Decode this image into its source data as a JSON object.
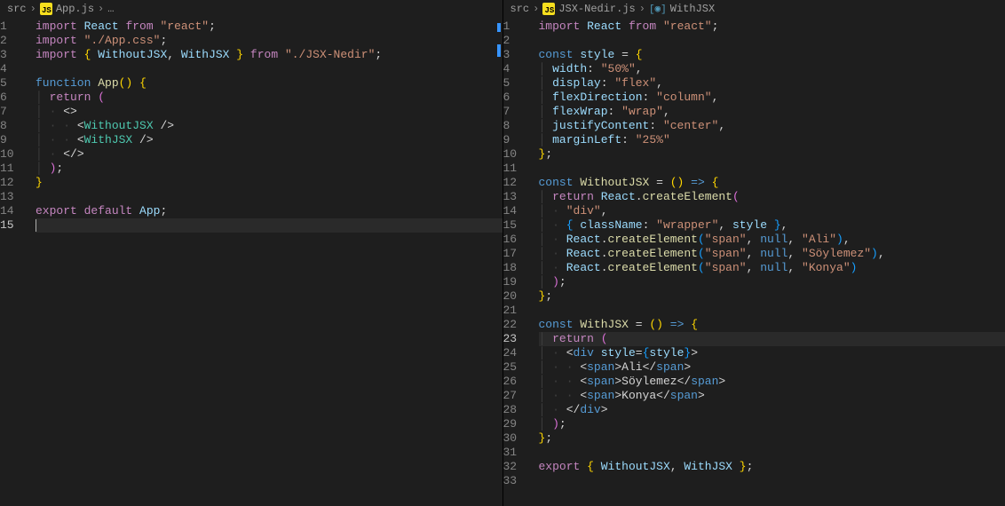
{
  "leftPane": {
    "breadcrumb": {
      "root": "src",
      "file": "App.js",
      "rest": "…"
    },
    "lines": [
      {
        "n": 1,
        "tokens": [
          [
            "k1",
            "import"
          ],
          [
            "punc",
            " "
          ],
          [
            "id",
            "React"
          ],
          [
            "punc",
            " "
          ],
          [
            "k1",
            "from"
          ],
          [
            "punc",
            " "
          ],
          [
            "str",
            "\"react\""
          ],
          [
            "punc",
            ";"
          ]
        ]
      },
      {
        "n": 2,
        "tokens": [
          [
            "k1",
            "import"
          ],
          [
            "punc",
            " "
          ],
          [
            "str",
            "\"./App.css\""
          ],
          [
            "punc",
            ";"
          ]
        ]
      },
      {
        "n": 3,
        "tokens": [
          [
            "k1",
            "import"
          ],
          [
            "punc",
            " "
          ],
          [
            "brace-y",
            "{"
          ],
          [
            "punc",
            " "
          ],
          [
            "id",
            "WithoutJSX"
          ],
          [
            "punc",
            ", "
          ],
          [
            "id",
            "WithJSX"
          ],
          [
            "punc",
            " "
          ],
          [
            "brace-y",
            "}"
          ],
          [
            "punc",
            " "
          ],
          [
            "k1",
            "from"
          ],
          [
            "punc",
            " "
          ],
          [
            "str",
            "\"./JSX-Nedir\""
          ],
          [
            "punc",
            ";"
          ]
        ]
      },
      {
        "n": 4,
        "tokens": []
      },
      {
        "n": 5,
        "tokens": [
          [
            "k2",
            "function"
          ],
          [
            "punc",
            " "
          ],
          [
            "fn",
            "App"
          ],
          [
            "brace-y",
            "()"
          ],
          [
            "punc",
            " "
          ],
          [
            "brace-y",
            "{"
          ]
        ]
      },
      {
        "n": 6,
        "tokens": [
          [
            "guide",
            "│ "
          ],
          [
            "k1",
            "return"
          ],
          [
            "punc",
            " "
          ],
          [
            "brace-p",
            "("
          ]
        ]
      },
      {
        "n": 7,
        "tokens": [
          [
            "guide",
            "│ · "
          ],
          [
            "punc",
            "<>"
          ]
        ]
      },
      {
        "n": 8,
        "tokens": [
          [
            "guide",
            "│ · · "
          ],
          [
            "punc",
            "<"
          ],
          [
            "tagname",
            "WithoutJSX"
          ],
          [
            "punc",
            " />"
          ]
        ]
      },
      {
        "n": 9,
        "tokens": [
          [
            "guide",
            "│ · · "
          ],
          [
            "punc",
            "<"
          ],
          [
            "tagname",
            "WithJSX"
          ],
          [
            "punc",
            " />"
          ]
        ]
      },
      {
        "n": 10,
        "tokens": [
          [
            "guide",
            "│ · "
          ],
          [
            "punc",
            "</>"
          ]
        ]
      },
      {
        "n": 11,
        "tokens": [
          [
            "guide",
            "│ "
          ],
          [
            "brace-p",
            ")"
          ],
          [
            "punc",
            ";"
          ]
        ]
      },
      {
        "n": 12,
        "tokens": [
          [
            "brace-y",
            "}"
          ]
        ]
      },
      {
        "n": 13,
        "tokens": []
      },
      {
        "n": 14,
        "tokens": [
          [
            "k1",
            "export"
          ],
          [
            "punc",
            " "
          ],
          [
            "k1",
            "default"
          ],
          [
            "punc",
            " "
          ],
          [
            "id",
            "App"
          ],
          [
            "punc",
            ";"
          ]
        ]
      },
      {
        "n": 15,
        "tokens": [],
        "current": true,
        "cursor": true
      }
    ]
  },
  "rightPane": {
    "breadcrumb": {
      "root": "src",
      "file": "JSX-Nedir.js",
      "symbol": "WithJSX"
    },
    "lines": [
      {
        "n": 1,
        "tokens": [
          [
            "k1",
            "import"
          ],
          [
            "punc",
            " "
          ],
          [
            "id",
            "React"
          ],
          [
            "punc",
            " "
          ],
          [
            "k1",
            "from"
          ],
          [
            "punc",
            " "
          ],
          [
            "str",
            "\"react\""
          ],
          [
            "punc",
            ";"
          ]
        ]
      },
      {
        "n": 2,
        "tokens": []
      },
      {
        "n": 3,
        "tokens": [
          [
            "k2",
            "const"
          ],
          [
            "punc",
            " "
          ],
          [
            "id",
            "style"
          ],
          [
            "punc",
            " = "
          ],
          [
            "brace-y",
            "{"
          ]
        ]
      },
      {
        "n": 4,
        "tokens": [
          [
            "guide",
            "│ "
          ],
          [
            "id",
            "width"
          ],
          [
            "punc",
            ": "
          ],
          [
            "str",
            "\"50%\""
          ],
          [
            "punc",
            ","
          ]
        ]
      },
      {
        "n": 5,
        "tokens": [
          [
            "guide",
            "│ "
          ],
          [
            "id",
            "display"
          ],
          [
            "punc",
            ": "
          ],
          [
            "str",
            "\"flex\""
          ],
          [
            "punc",
            ","
          ]
        ]
      },
      {
        "n": 6,
        "tokens": [
          [
            "guide",
            "│ "
          ],
          [
            "id",
            "flexDirection"
          ],
          [
            "punc",
            ": "
          ],
          [
            "str",
            "\"column\""
          ],
          [
            "punc",
            ","
          ]
        ]
      },
      {
        "n": 7,
        "tokens": [
          [
            "guide",
            "│ "
          ],
          [
            "id",
            "flexWrap"
          ],
          [
            "punc",
            ": "
          ],
          [
            "str",
            "\"wrap\""
          ],
          [
            "punc",
            ","
          ]
        ]
      },
      {
        "n": 8,
        "tokens": [
          [
            "guide",
            "│ "
          ],
          [
            "id",
            "justifyContent"
          ],
          [
            "punc",
            ": "
          ],
          [
            "str",
            "\"center\""
          ],
          [
            "punc",
            ","
          ]
        ]
      },
      {
        "n": 9,
        "tokens": [
          [
            "guide",
            "│ "
          ],
          [
            "id",
            "marginLeft"
          ],
          [
            "punc",
            ": "
          ],
          [
            "str",
            "\"25%\""
          ]
        ]
      },
      {
        "n": 10,
        "tokens": [
          [
            "brace-y",
            "}"
          ],
          [
            "punc",
            ";"
          ]
        ]
      },
      {
        "n": 11,
        "tokens": []
      },
      {
        "n": 12,
        "tokens": [
          [
            "k2",
            "const"
          ],
          [
            "punc",
            " "
          ],
          [
            "fn",
            "WithoutJSX"
          ],
          [
            "punc",
            " = "
          ],
          [
            "brace-y",
            "()"
          ],
          [
            "punc",
            " "
          ],
          [
            "k2",
            "=>"
          ],
          [
            "punc",
            " "
          ],
          [
            "brace-y",
            "{"
          ]
        ]
      },
      {
        "n": 13,
        "tokens": [
          [
            "guide",
            "│ "
          ],
          [
            "k1",
            "return"
          ],
          [
            "punc",
            " "
          ],
          [
            "id",
            "React"
          ],
          [
            "punc",
            "."
          ],
          [
            "fn",
            "createElement"
          ],
          [
            "brace-p",
            "("
          ]
        ]
      },
      {
        "n": 14,
        "tokens": [
          [
            "guide",
            "│ · "
          ],
          [
            "str",
            "\"div\""
          ],
          [
            "punc",
            ","
          ]
        ]
      },
      {
        "n": 15,
        "tokens": [
          [
            "guide",
            "│ · "
          ],
          [
            "brace-b",
            "{"
          ],
          [
            "punc",
            " "
          ],
          [
            "id",
            "className"
          ],
          [
            "punc",
            ": "
          ],
          [
            "str",
            "\"wrapper\""
          ],
          [
            "punc",
            ", "
          ],
          [
            "id",
            "style"
          ],
          [
            "punc",
            " "
          ],
          [
            "brace-b",
            "}"
          ],
          [
            "punc",
            ","
          ]
        ]
      },
      {
        "n": 16,
        "tokens": [
          [
            "guide",
            "│ · "
          ],
          [
            "id",
            "React"
          ],
          [
            "punc",
            "."
          ],
          [
            "fn",
            "createElement"
          ],
          [
            "brace-b",
            "("
          ],
          [
            "str",
            "\"span\""
          ],
          [
            "punc",
            ", "
          ],
          [
            "k2",
            "null"
          ],
          [
            "punc",
            ", "
          ],
          [
            "str",
            "\"Ali\""
          ],
          [
            "brace-b",
            ")"
          ],
          [
            "punc",
            ","
          ]
        ]
      },
      {
        "n": 17,
        "tokens": [
          [
            "guide",
            "│ · "
          ],
          [
            "id",
            "React"
          ],
          [
            "punc",
            "."
          ],
          [
            "fn",
            "createElement"
          ],
          [
            "brace-b",
            "("
          ],
          [
            "str",
            "\"span\""
          ],
          [
            "punc",
            ", "
          ],
          [
            "k2",
            "null"
          ],
          [
            "punc",
            ", "
          ],
          [
            "str",
            "\"Söylemez\""
          ],
          [
            "brace-b",
            ")"
          ],
          [
            "punc",
            ","
          ]
        ]
      },
      {
        "n": 18,
        "tokens": [
          [
            "guide",
            "│ · "
          ],
          [
            "id",
            "React"
          ],
          [
            "punc",
            "."
          ],
          [
            "fn",
            "createElement"
          ],
          [
            "brace-b",
            "("
          ],
          [
            "str",
            "\"span\""
          ],
          [
            "punc",
            ", "
          ],
          [
            "k2",
            "null"
          ],
          [
            "punc",
            ", "
          ],
          [
            "str",
            "\"Konya\""
          ],
          [
            "brace-b",
            ")"
          ]
        ]
      },
      {
        "n": 19,
        "tokens": [
          [
            "guide",
            "│ "
          ],
          [
            "brace-p",
            ")"
          ],
          [
            "punc",
            ";"
          ]
        ]
      },
      {
        "n": 20,
        "tokens": [
          [
            "brace-y",
            "}"
          ],
          [
            "punc",
            ";"
          ]
        ]
      },
      {
        "n": 21,
        "tokens": []
      },
      {
        "n": 22,
        "tokens": [
          [
            "k2",
            "const"
          ],
          [
            "punc",
            " "
          ],
          [
            "fn",
            "WithJSX"
          ],
          [
            "punc",
            " = "
          ],
          [
            "brace-y",
            "()"
          ],
          [
            "punc",
            " "
          ],
          [
            "k2",
            "=>"
          ],
          [
            "punc",
            " "
          ],
          [
            "brace-y",
            "{"
          ]
        ]
      },
      {
        "n": 23,
        "tokens": [
          [
            "guide",
            "│ "
          ],
          [
            "k1",
            "return"
          ],
          [
            "punc",
            " "
          ],
          [
            "brace-p",
            "("
          ]
        ],
        "current": true
      },
      {
        "n": 24,
        "tokens": [
          [
            "guide",
            "│ · "
          ],
          [
            "punc",
            "<"
          ],
          [
            "tag",
            "div"
          ],
          [
            "punc",
            " "
          ],
          [
            "id",
            "style"
          ],
          [
            "punc",
            "="
          ],
          [
            "brace-b",
            "{"
          ],
          [
            "id",
            "style"
          ],
          [
            "brace-b",
            "}"
          ],
          [
            "punc",
            ">"
          ]
        ]
      },
      {
        "n": 25,
        "tokens": [
          [
            "guide",
            "│ · · "
          ],
          [
            "punc",
            "<"
          ],
          [
            "tag",
            "span"
          ],
          [
            "punc",
            ">"
          ],
          [
            "punc",
            "Ali"
          ],
          [
            "punc",
            "</"
          ],
          [
            "tag",
            "span"
          ],
          [
            "punc",
            ">"
          ]
        ]
      },
      {
        "n": 26,
        "tokens": [
          [
            "guide",
            "│ · · "
          ],
          [
            "punc",
            "<"
          ],
          [
            "tag",
            "span"
          ],
          [
            "punc",
            ">"
          ],
          [
            "punc",
            "Söylemez"
          ],
          [
            "punc",
            "</"
          ],
          [
            "tag",
            "span"
          ],
          [
            "punc",
            ">"
          ]
        ]
      },
      {
        "n": 27,
        "tokens": [
          [
            "guide",
            "│ · · "
          ],
          [
            "punc",
            "<"
          ],
          [
            "tag",
            "span"
          ],
          [
            "punc",
            ">"
          ],
          [
            "punc",
            "Konya"
          ],
          [
            "punc",
            "</"
          ],
          [
            "tag",
            "span"
          ],
          [
            "punc",
            ">"
          ]
        ]
      },
      {
        "n": 28,
        "tokens": [
          [
            "guide",
            "│ · "
          ],
          [
            "punc",
            "</"
          ],
          [
            "tag",
            "div"
          ],
          [
            "punc",
            ">"
          ]
        ]
      },
      {
        "n": 29,
        "tokens": [
          [
            "guide",
            "│ "
          ],
          [
            "brace-p",
            ")"
          ],
          [
            "punc",
            ";"
          ]
        ]
      },
      {
        "n": 30,
        "tokens": [
          [
            "brace-y",
            "}"
          ],
          [
            "punc",
            ";"
          ]
        ]
      },
      {
        "n": 31,
        "tokens": []
      },
      {
        "n": 32,
        "tokens": [
          [
            "k1",
            "export"
          ],
          [
            "punc",
            " "
          ],
          [
            "brace-y",
            "{"
          ],
          [
            "punc",
            " "
          ],
          [
            "id",
            "WithoutJSX"
          ],
          [
            "punc",
            ", "
          ],
          [
            "id",
            "WithJSX"
          ],
          [
            "punc",
            " "
          ],
          [
            "brace-y",
            "}"
          ],
          [
            "punc",
            ";"
          ]
        ]
      },
      {
        "n": 33,
        "tokens": []
      }
    ]
  }
}
